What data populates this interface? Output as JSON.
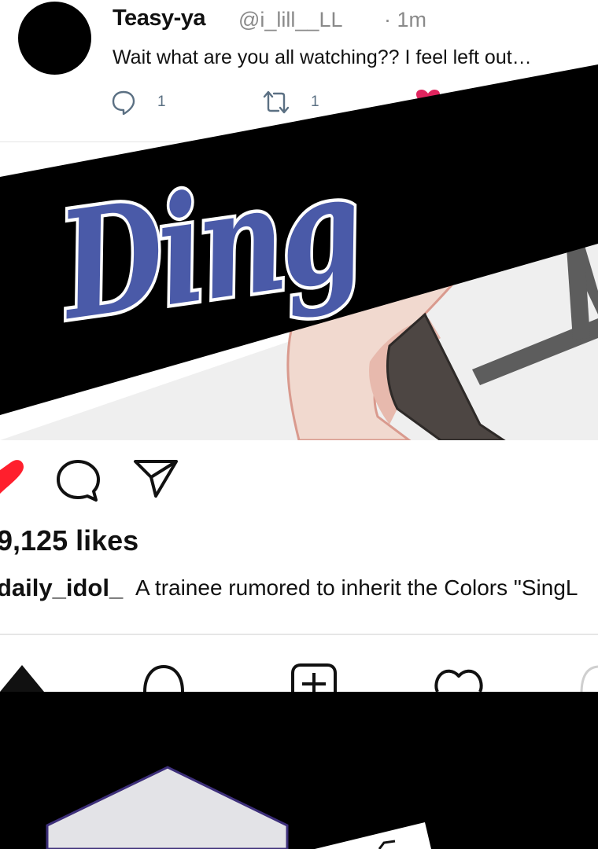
{
  "tweet": {
    "name": "Teasy-ya",
    "handle": "@i_lill__LL",
    "time": "· 1m",
    "text": "Wait what are you all watching?? I feel left out…",
    "reply_count": "1",
    "retweet_count": "1"
  },
  "panel": {
    "sfx": "Ding"
  },
  "post": {
    "likes": "9,125 likes",
    "username": "daily_idol_",
    "caption": "A trainee rumored to inherit the Colors \"SingL"
  },
  "colors": {
    "heart_red": "#ff1f2d",
    "sfx_blue": "#4a5aa8",
    "tweet_heart": "#e0245e"
  },
  "icons": [
    "comment-icon",
    "retweet-icon",
    "heart-icon",
    "send-icon",
    "home-icon",
    "search-icon",
    "add-post-icon",
    "activity-heart-icon",
    "profile-avatar-icon"
  ]
}
